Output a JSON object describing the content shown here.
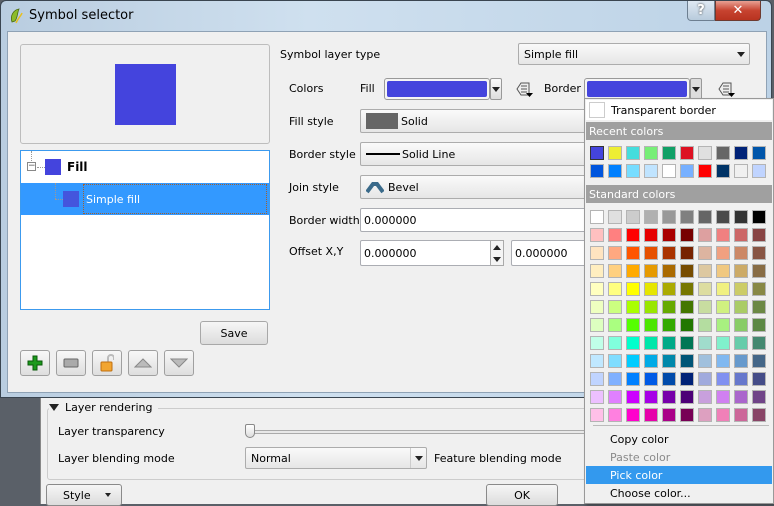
{
  "parent_dialog": {
    "group_title": "Layer rendering",
    "transparency_label": "Layer transparency",
    "transparency_value": 0,
    "blending_label": "Layer blending mode",
    "blending_value": "Normal",
    "feature_blending_label": "Feature blending mode",
    "style_button": "Style",
    "ok_button": "OK"
  },
  "dialog": {
    "title": "Symbol selector",
    "help_label": "?",
    "close_label": "✕",
    "preview_color": "#4444dd"
  },
  "tree": {
    "items": [
      {
        "label": "Fill",
        "color": "#4444dd",
        "selected": false
      },
      {
        "label": "Simple fill",
        "color": "#4455dd",
        "selected": true
      }
    ]
  },
  "toolbar": {
    "add_label": "add-layer",
    "remove_label": "remove-layer",
    "lock_label": "lock-color",
    "up_label": "move-up",
    "down_label": "move-down",
    "save_label": "Save"
  },
  "props": {
    "layer_type_label": "Symbol layer type",
    "layer_type_value": "Simple fill",
    "colors_label": "Colors",
    "fill_label": "Fill",
    "fill_color": "#4444dd",
    "border_label": "Border",
    "border_color": "#4444dd",
    "fill_style_label": "Fill style",
    "fill_style_value": "Solid",
    "border_style_label": "Border style",
    "border_style_value": "Solid Line",
    "join_style_label": "Join style",
    "join_style_value": "Bevel",
    "border_width_label": "Border width",
    "border_width_value": "0.000000",
    "offset_label": "Offset X,Y",
    "offset_x": "0.000000",
    "offset_y": "0.000000"
  },
  "color_popup": {
    "transparent_label": "Transparent border",
    "recent_title": "Recent colors",
    "recent": [
      "#4444dd",
      "#eeee33",
      "#44dddd",
      "#77ee77",
      "#11a066",
      "#dd1122",
      "#e0e0e0",
      "#666666",
      "#002277",
      "#0055aa",
      "#0055dd",
      "#0080ff",
      "#77ddff",
      "#c0e4ff",
      "#ffffff",
      "#77b0ff",
      "#ff0000",
      "#003366",
      "#f0f0f0",
      "#c0d4ff"
    ],
    "standard_title": "Standard colors",
    "standard": [
      [
        "#ffffff",
        "#e0e0e0",
        "#cccccc",
        "#b0b0b0",
        "#999999",
        "#808080",
        "#666666",
        "#4a4a4a",
        "#333333",
        "#000000"
      ],
      [
        "#ffc0c0",
        "#ff8080",
        "#ff0000",
        "#e60000",
        "#aa0000",
        "#770000",
        "#dda0a0",
        "#f08080",
        "#cc6666",
        "#884444"
      ],
      [
        "#ffe4c0",
        "#ffa880",
        "#ff5500",
        "#e65000",
        "#aa3300",
        "#772200",
        "#ddb4a0",
        "#f0a080",
        "#cc8866",
        "#885544"
      ],
      [
        "#ffeec0",
        "#ffd080",
        "#ffaa00",
        "#e69a00",
        "#aa6a00",
        "#774c00",
        "#ddc8a0",
        "#f0c880",
        "#ccaa66",
        "#886c44"
      ],
      [
        "#ffffc0",
        "#ffff80",
        "#ffff00",
        "#e6e600",
        "#aaaa00",
        "#777700",
        "#dddda0",
        "#f0f080",
        "#cccc66",
        "#888844"
      ],
      [
        "#eeffc0",
        "#ccff80",
        "#aaff00",
        "#99e600",
        "#66aa00",
        "#447700",
        "#c8dda0",
        "#d0f080",
        "#aacc66",
        "#6c8844"
      ],
      [
        "#ddffc0",
        "#aaff80",
        "#55ff00",
        "#4ce600",
        "#33aa00",
        "#227700",
        "#b4dda0",
        "#a8f080",
        "#88cc66",
        "#5c8844"
      ],
      [
        "#c0ffe8",
        "#80ffdd",
        "#00ffcc",
        "#00e6aa",
        "#00aa88",
        "#007755",
        "#a0dccc",
        "#80f0cc",
        "#66ccaa",
        "#448870"
      ],
      [
        "#c0e8ff",
        "#80ddff",
        "#00ccff",
        "#00aae6",
        "#0088aa",
        "#005577",
        "#a0c0dd",
        "#80b8f0",
        "#6699cc",
        "#446688"
      ],
      [
        "#c0d4ff",
        "#80b0ff",
        "#0080ff",
        "#005ae6",
        "#004aaa",
        "#002277",
        "#a0aadd",
        "#8090f0",
        "#6677cc",
        "#444c88"
      ],
      [
        "#ecc0ff",
        "#e080ff",
        "#cc00ff",
        "#a600e6",
        "#7700aa",
        "#4c0077",
        "#c8a0dd",
        "#d080f0",
        "#aa66cc",
        "#704488"
      ],
      [
        "#ffc0e8",
        "#ff80e0",
        "#ff00cc",
        "#e600aa",
        "#aa0088",
        "#770055",
        "#dda0c0",
        "#f080b8",
        "#cc6699",
        "#884466"
      ]
    ],
    "menu": [
      {
        "label": "Copy color",
        "state": "normal"
      },
      {
        "label": "Paste color",
        "state": "disabled"
      },
      {
        "label": "Pick color",
        "state": "active"
      },
      {
        "label": "Choose color...",
        "state": "normal"
      }
    ]
  }
}
